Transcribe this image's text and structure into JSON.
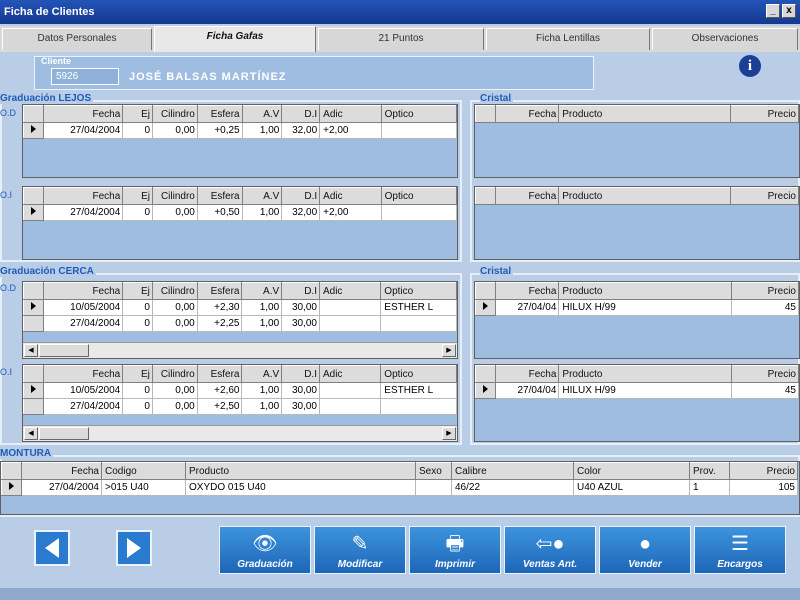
{
  "window": {
    "title": "Ficha de Clientes",
    "controls": [
      "_",
      "x"
    ]
  },
  "tabs": [
    "Datos Personales",
    "Ficha Gafas",
    "21 Puntos",
    "Ficha Lentillas",
    "Observaciones"
  ],
  "client": {
    "label": "Cliente",
    "code": "5926",
    "name": "JOSÉ BALSAS MARTÍNEZ"
  },
  "graduacion_lejos": {
    "title": "Graduación LEJOS",
    "od_label": "O.D",
    "oi_label": "O.I",
    "headers": [
      "Fecha",
      "Ej",
      "Cilindro",
      "Esfera",
      "A.V",
      "D.I",
      "Adic",
      "Optico"
    ],
    "od_rows": [
      [
        "27/04/2004",
        "0",
        "0,00",
        "+0,25",
        "1,00",
        "32,00",
        "+2,00",
        ""
      ]
    ],
    "oi_rows": [
      [
        "27/04/2004",
        "0",
        "0,00",
        "+0,50",
        "1,00",
        "32,00",
        "+2,00",
        ""
      ]
    ]
  },
  "graduacion_cerca": {
    "title": "Graduación CERCA",
    "od_label": "O.D",
    "oi_label": "O.I",
    "headers": [
      "Fecha",
      "Ej",
      "Cilindro",
      "Esfera",
      "A.V",
      "D.I",
      "Adic",
      "Optico"
    ],
    "od_rows": [
      [
        "10/05/2004",
        "0",
        "0,00",
        "+2,30",
        "1,00",
        "30,00",
        "",
        "ESTHER L"
      ],
      [
        "27/04/2004",
        "0",
        "0,00",
        "+2,25",
        "1,00",
        "30,00",
        "",
        ""
      ]
    ],
    "oi_rows": [
      [
        "10/05/2004",
        "0",
        "0,00",
        "+2,60",
        "1,00",
        "30,00",
        "",
        "ESTHER L"
      ],
      [
        "27/04/2004",
        "0",
        "0,00",
        "+2,50",
        "1,00",
        "30,00",
        "",
        ""
      ]
    ]
  },
  "cristal_lejos": {
    "title": "Cristal",
    "headers": [
      "Fecha",
      "Producto",
      "Precio"
    ],
    "od_rows": [],
    "oi_rows": []
  },
  "cristal_cerca": {
    "title": "Cristal",
    "headers": [
      "Fecha",
      "Producto",
      "Precio"
    ],
    "od_rows": [
      [
        "27/04/04",
        "HILUX H/99",
        "45"
      ]
    ],
    "oi_rows": [
      [
        "27/04/04",
        "HILUX H/99",
        "45"
      ]
    ]
  },
  "montura": {
    "title": "MONTURA",
    "headers": [
      "Fecha",
      "Codigo",
      "Producto",
      "Sexo",
      "Calibre",
      "Color",
      "Prov.",
      "Precio"
    ],
    "rows": [
      [
        "27/04/2004",
        ">015 U40",
        "OXYDO 015 U40",
        "",
        "46/22",
        "U40 AZUL",
        "1",
        "105"
      ]
    ]
  },
  "buttons": {
    "graduacion": "Graduación",
    "modificar": "Modificar",
    "imprimir": "Imprimir",
    "ventas_ant": "Ventas Ant.",
    "vender": "Vender",
    "encargos": "Encargos"
  },
  "icons": {
    "info": "info-icon",
    "prev": "arrow-left-icon",
    "next": "arrow-right-icon"
  },
  "colors": {
    "accent": "#1e5cb8",
    "button": "#2a7ad0",
    "background": "#b9cde6"
  }
}
